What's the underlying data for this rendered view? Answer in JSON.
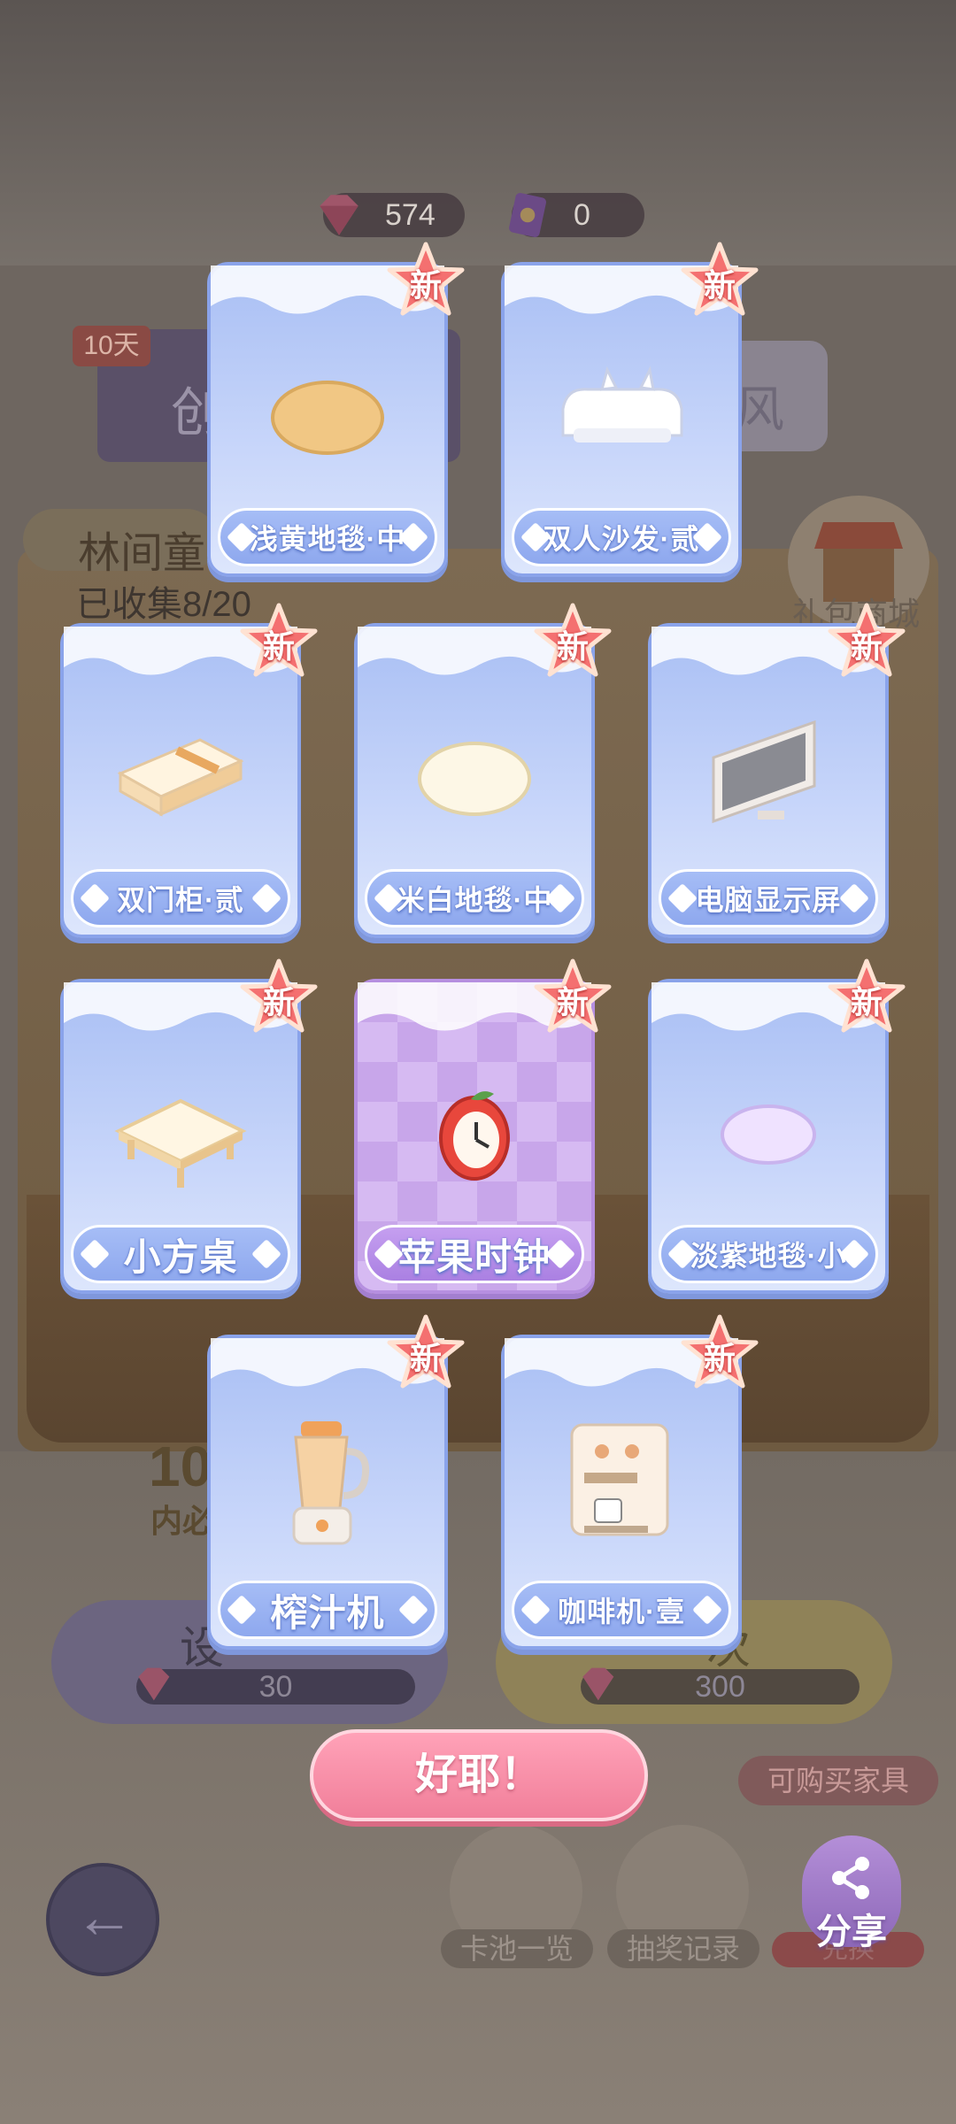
{
  "currency": {
    "gems": "574",
    "tickets": "0"
  },
  "background": {
    "days_tag": "10天",
    "panel_text": "创",
    "panel_right_text": "风",
    "collection_title": "林间童",
    "collected_text": "已收集8/20",
    "shop_label": "礼包商城",
    "count_text": "10",
    "count_sub": "内必",
    "draw_once_title": "设",
    "draw_once_cost": "30",
    "draw_ten_title": "次",
    "draw_ten_cost": "300",
    "purchasable": "可购买家具",
    "pool_overview": "卡池一览",
    "draw_history": "抽奖记录",
    "exchange": "兑换"
  },
  "reward": {
    "new_badge": "新",
    "items": [
      {
        "name": "浅黄地毯·中",
        "rarity": "blue",
        "icon": "beige-round-rug-icon"
      },
      {
        "name": "双人沙发·贰",
        "rarity": "blue",
        "icon": "white-cat-sofa-icon"
      },
      {
        "name": "双门柜·贰",
        "rarity": "blue",
        "icon": "double-door-cabinet-icon"
      },
      {
        "name": "米白地毯·中",
        "rarity": "blue",
        "icon": "cream-round-rug-icon"
      },
      {
        "name": "电脑显示屏",
        "rarity": "blue",
        "icon": "computer-monitor-icon"
      },
      {
        "name": "小方桌",
        "rarity": "blue",
        "icon": "small-square-table-icon"
      },
      {
        "name": "苹果时钟",
        "rarity": "purple",
        "icon": "apple-clock-icon"
      },
      {
        "name": "淡紫地毯·小",
        "rarity": "blue",
        "icon": "lavender-round-rug-icon"
      },
      {
        "name": "榨汁机",
        "rarity": "blue",
        "icon": "juicer-icon"
      },
      {
        "name": "咖啡机·壹",
        "rarity": "blue",
        "icon": "coffee-machine-icon"
      }
    ],
    "confirm_label": "好耶！"
  },
  "share_label": "分享",
  "colors": {
    "card_blue": "#a9bff4",
    "card_purple": "#c9aee8",
    "badge_red": "#f06a6a",
    "confirm_pink": "#f17f9a"
  }
}
